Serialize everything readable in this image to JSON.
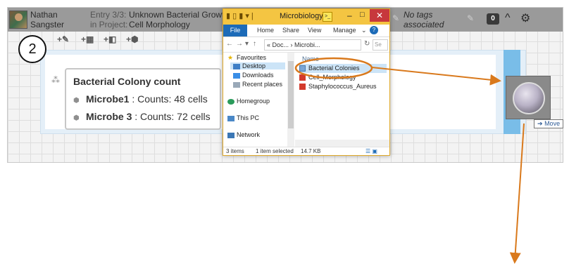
{
  "header": {
    "user_first": "Nathan",
    "user_last": "Sangster",
    "entry_label": "Entry 3/3:",
    "entry_title": "Unknown Bacterial Growth",
    "project_label": "in Project:",
    "project_name": "Cell Morphology",
    "tags_line1": "No tags",
    "tags_line2": "associated",
    "comment_count": "0"
  },
  "toolbar": {
    "items": [
      "+",
      "+",
      "+",
      "+"
    ]
  },
  "step_number": "2",
  "card": {
    "title": "Bacterial Colony count",
    "rows": [
      {
        "name": "Microbe1",
        "value": " : Counts: 48 cells"
      },
      {
        "name": "Microbe 3",
        "value": " : Counts: 72 cells"
      }
    ]
  },
  "explorer": {
    "title": "Microbiology",
    "ribbon_tabs": [
      "File",
      "Home",
      "Share",
      "View",
      "Manage"
    ],
    "address": "« Doc... › Microbi...",
    "search_placeholder": "Se",
    "nav_items": [
      "Favourites",
      "Desktop",
      "Downloads",
      "Recent places",
      "Homegroup",
      "This PC",
      "Network"
    ],
    "column_header": "Name",
    "files": [
      "Bacterial Colonies",
      "Cell_Morphology",
      "Staphylococcus_Aureus"
    ],
    "status_items": "3 items",
    "status_selected": "1 item selected",
    "status_size": "14.7 KB"
  },
  "drag": {
    "action_label": "Move"
  },
  "colors": {
    "annotation": "#d9791c",
    "title_bar": "#f4c542",
    "selection": "#cce4f7"
  }
}
